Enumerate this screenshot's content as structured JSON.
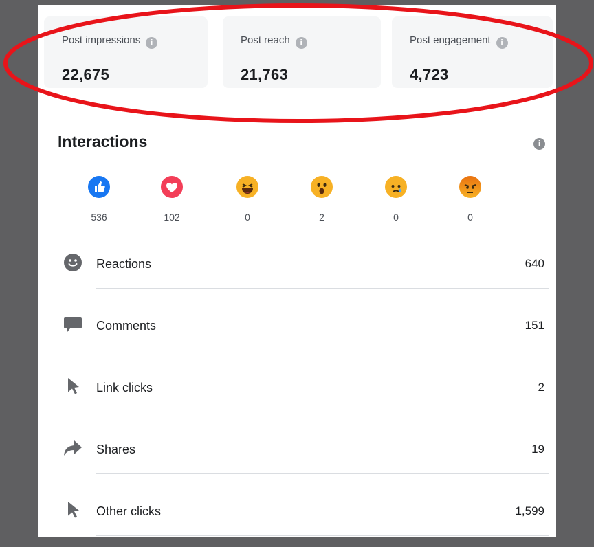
{
  "stats": [
    {
      "label": "Post impressions",
      "value": "22,675"
    },
    {
      "label": "Post reach",
      "value": "21,763"
    },
    {
      "label": "Post engagement",
      "value": "4,723"
    }
  ],
  "interactions": {
    "title": "Interactions",
    "reactions": [
      {
        "icon": "like-icon",
        "count": "536"
      },
      {
        "icon": "love-icon",
        "count": "102"
      },
      {
        "icon": "haha-icon",
        "count": "0"
      },
      {
        "icon": "wow-icon",
        "count": "2"
      },
      {
        "icon": "sad-icon",
        "count": "0"
      },
      {
        "icon": "angry-icon",
        "count": "0"
      }
    ],
    "items": [
      {
        "icon": "smiley-icon",
        "label": "Reactions",
        "value": "640"
      },
      {
        "icon": "comment-bubble-icon",
        "label": "Comments",
        "value": "151"
      },
      {
        "icon": "cursor-icon",
        "label": "Link clicks",
        "value": "2"
      },
      {
        "icon": "share-arrow-icon",
        "label": "Shares",
        "value": "19"
      },
      {
        "icon": "cursor-icon",
        "label": "Other clicks",
        "value": "1,599"
      }
    ]
  },
  "colors": {
    "background": "#5f5f61",
    "annotation_ellipse": "#e8141a",
    "like_blue": "#1877f2",
    "love_red": "#f33e58",
    "emoji_yellow": "#f7b125"
  }
}
